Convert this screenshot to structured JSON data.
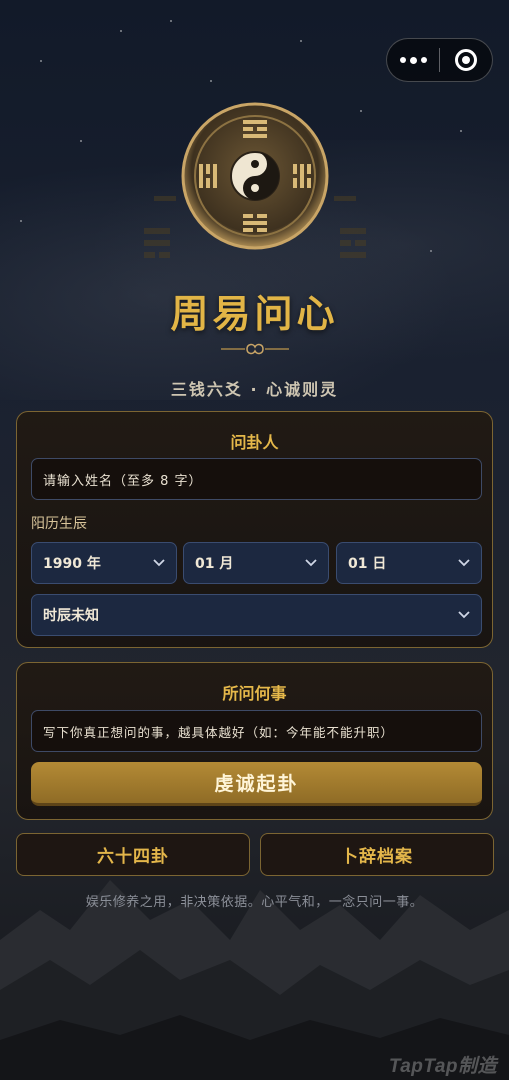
{
  "capsule": {
    "more_icon": "more-dots-icon",
    "close_icon": "target-circle-icon"
  },
  "header": {
    "title": "周易问心",
    "subtitle": "三钱六爻 · 心诚则灵"
  },
  "form": {
    "asker_title": "问卦人",
    "name_placeholder": "请输入姓名（至多 8 字）",
    "birth_label": "阳历生辰",
    "year_value": "1990 年",
    "month_value": "01 月",
    "day_value": "01 日",
    "hour_value": "时辰未知"
  },
  "question": {
    "title": "所问何事",
    "placeholder": "写下你真正想问的事，越具体越好（如：今年能不能升职）",
    "submit_label": "虔诚起卦"
  },
  "actions": {
    "hexagrams_label": "六十四卦",
    "archive_label": "卜辞档案"
  },
  "disclaimer": "娱乐修养之用，非决策依据。心平气和，一念只问一事。",
  "watermark": "TapTap制造",
  "colors": {
    "gold": "#e2b546",
    "card_border": "#7c6532",
    "select_bg": "#1c2840"
  }
}
